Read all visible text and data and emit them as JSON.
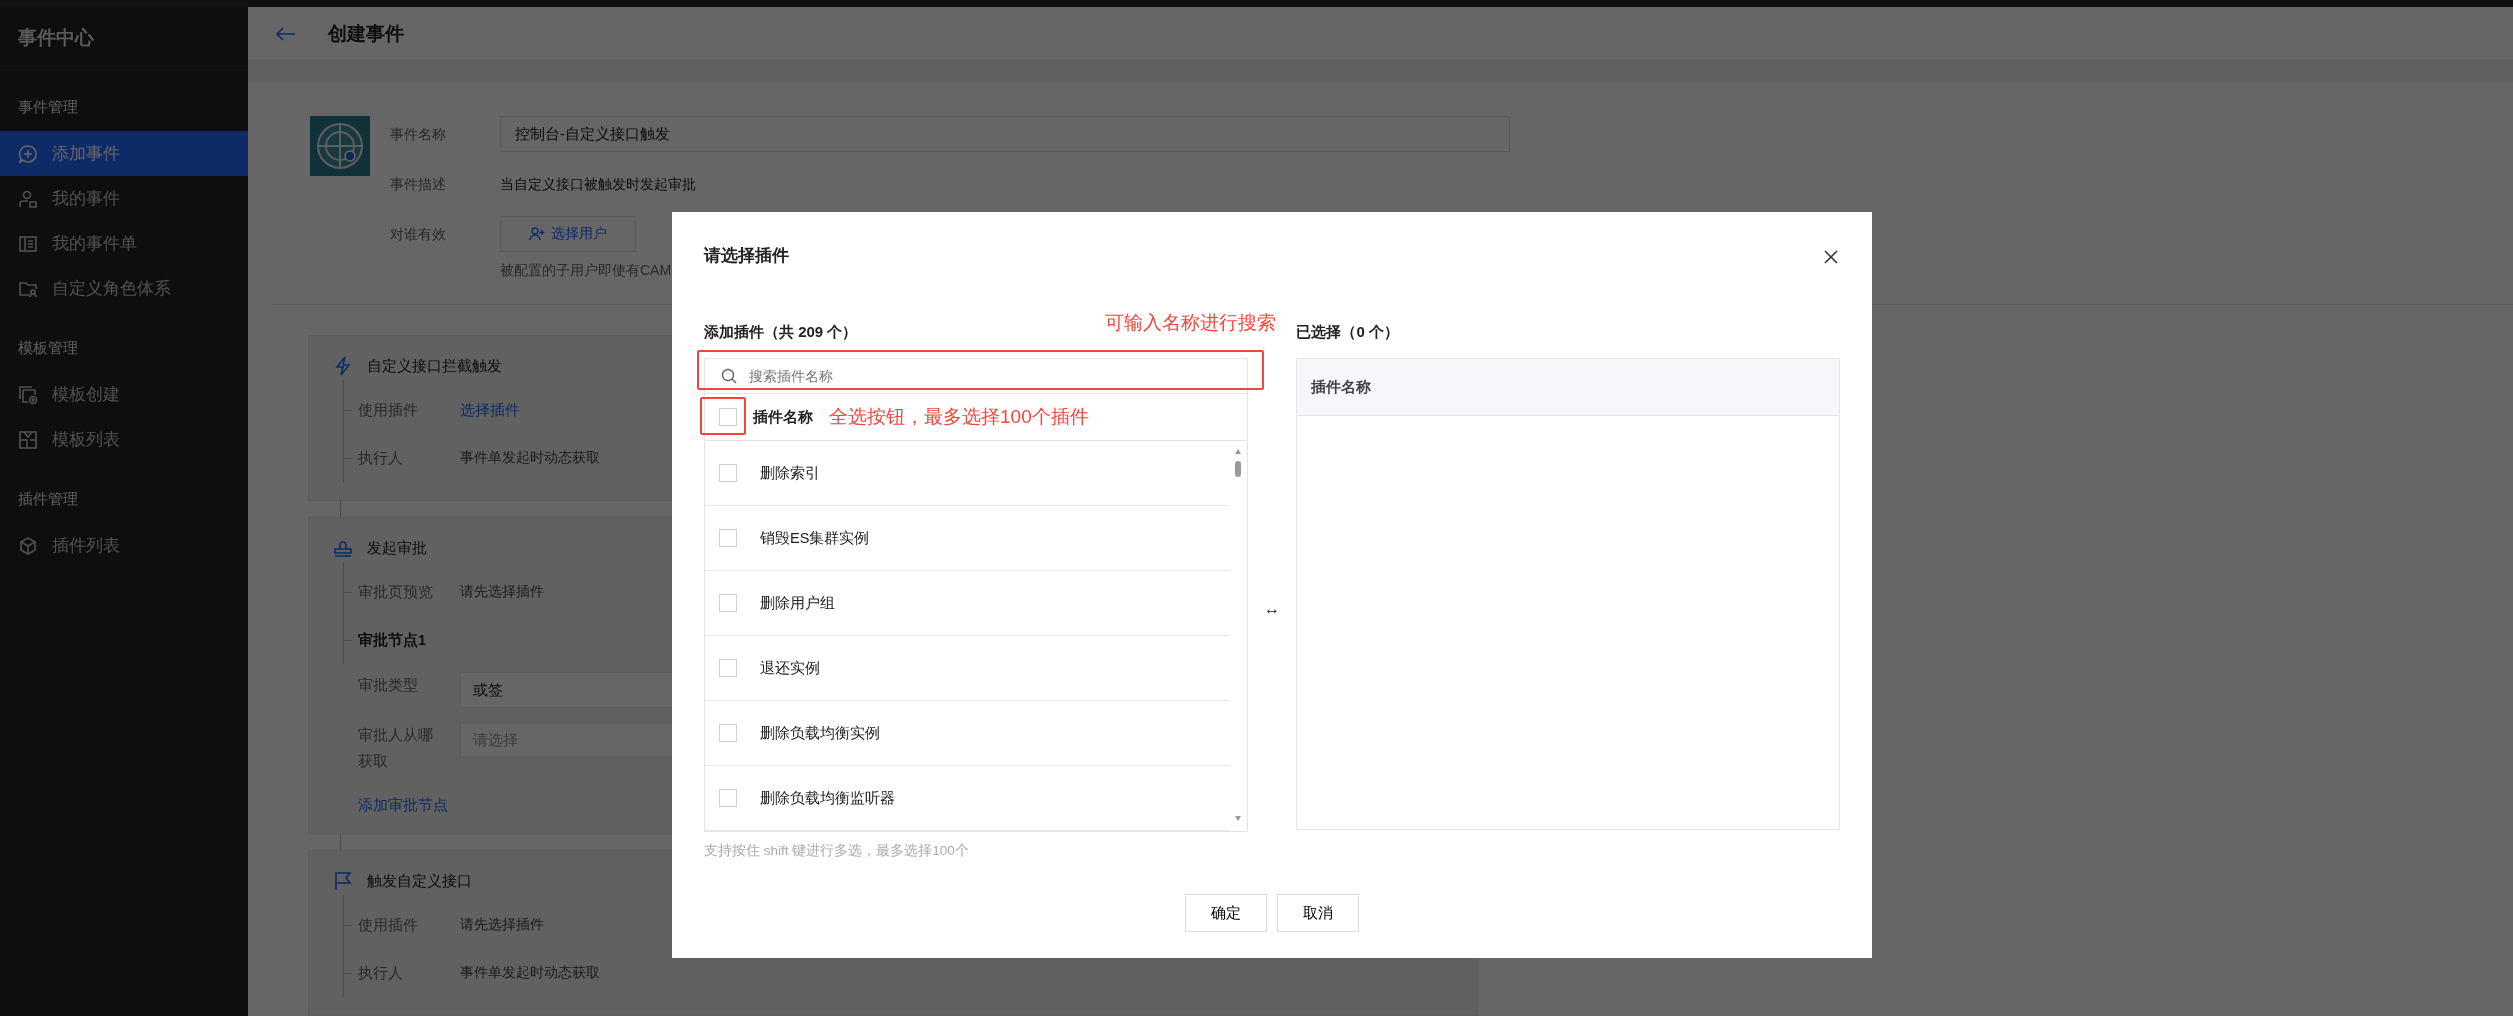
{
  "sidebar": {
    "title": "事件中心",
    "groups": [
      {
        "label": "事件管理",
        "items": [
          {
            "label": "添加事件",
            "kind": "add",
            "selected": true
          },
          {
            "label": "我的事件",
            "kind": "user",
            "selected": false
          },
          {
            "label": "我的事件单",
            "kind": "list",
            "selected": false
          },
          {
            "label": "自定义角色体系",
            "kind": "folder",
            "selected": false
          }
        ]
      },
      {
        "label": "模板管理",
        "items": [
          {
            "label": "模板创建",
            "kind": "copy",
            "selected": false
          },
          {
            "label": "模板列表",
            "kind": "board",
            "selected": false
          }
        ]
      },
      {
        "label": "插件管理",
        "items": [
          {
            "label": "插件列表",
            "kind": "cube",
            "selected": false
          }
        ]
      }
    ]
  },
  "header": {
    "title": "创建事件"
  },
  "event": {
    "fields": [
      {
        "label": "事件名称",
        "kind": "input",
        "value": "控制台-自定义接口触发"
      },
      {
        "label": "事件描述",
        "kind": "text",
        "value": "当自定义接口被触发时发起审批"
      },
      {
        "label": "对谁有效",
        "kind": "button",
        "value": "选择用户",
        "hint": "被配置的子用户即使有CAM"
      }
    ]
  },
  "flow": [
    {
      "title": "自定义接口拦截触发",
      "kind": "bolt",
      "rows": [
        {
          "label": "使用插件",
          "kind": "link",
          "value": "选择插件"
        },
        {
          "label": "执行人",
          "kind": "text",
          "value": "事件单发起时动态获取"
        }
      ]
    },
    {
      "title": "发起审批",
      "kind": "stamp",
      "rows": [
        {
          "label": "审批页预览",
          "kind": "text",
          "value": "请先选择插件"
        },
        {
          "label": "审批节点1",
          "kind": "heading"
        }
      ],
      "node_fields": [
        {
          "label": "审批类型",
          "value": "或签"
        },
        {
          "label": "审批人从哪获取",
          "placeholder": "请选择"
        }
      ],
      "action": "添加审批节点"
    },
    {
      "title": "触发自定义接口",
      "kind": "flag",
      "rows": [
        {
          "label": "使用插件",
          "kind": "text",
          "value": "请先选择插件"
        },
        {
          "label": "执行人",
          "kind": "text",
          "value": "事件单发起时动态获取"
        }
      ]
    }
  ],
  "dialog": {
    "title": "请选择插件",
    "left_title": "添加插件（共 209 个）",
    "right_title": "已选择（0 个）",
    "search": {
      "placeholder": "搜索插件名称"
    },
    "column": "插件名称",
    "select_all": {
      "checked": false
    },
    "items": [
      {
        "label": "删除索引",
        "checked": false
      },
      {
        "label": "销毁ES集群实例",
        "checked": false
      },
      {
        "label": "删除用户组",
        "checked": false
      },
      {
        "label": "退还实例",
        "checked": false
      },
      {
        "label": "删除负载均衡实例",
        "checked": false
      },
      {
        "label": "删除负载均衡监听器",
        "checked": false
      }
    ],
    "right_column": "插件名称",
    "transfer": "↔",
    "hint": "支持按住 shift 键进行多选，最多选择100个",
    "buttons": [
      {
        "label": "确定"
      },
      {
        "label": "取消"
      }
    ],
    "annotations": {
      "search": "可输入名称进行搜索",
      "select_all": "全选按钮，最多选择100个插件"
    }
  }
}
